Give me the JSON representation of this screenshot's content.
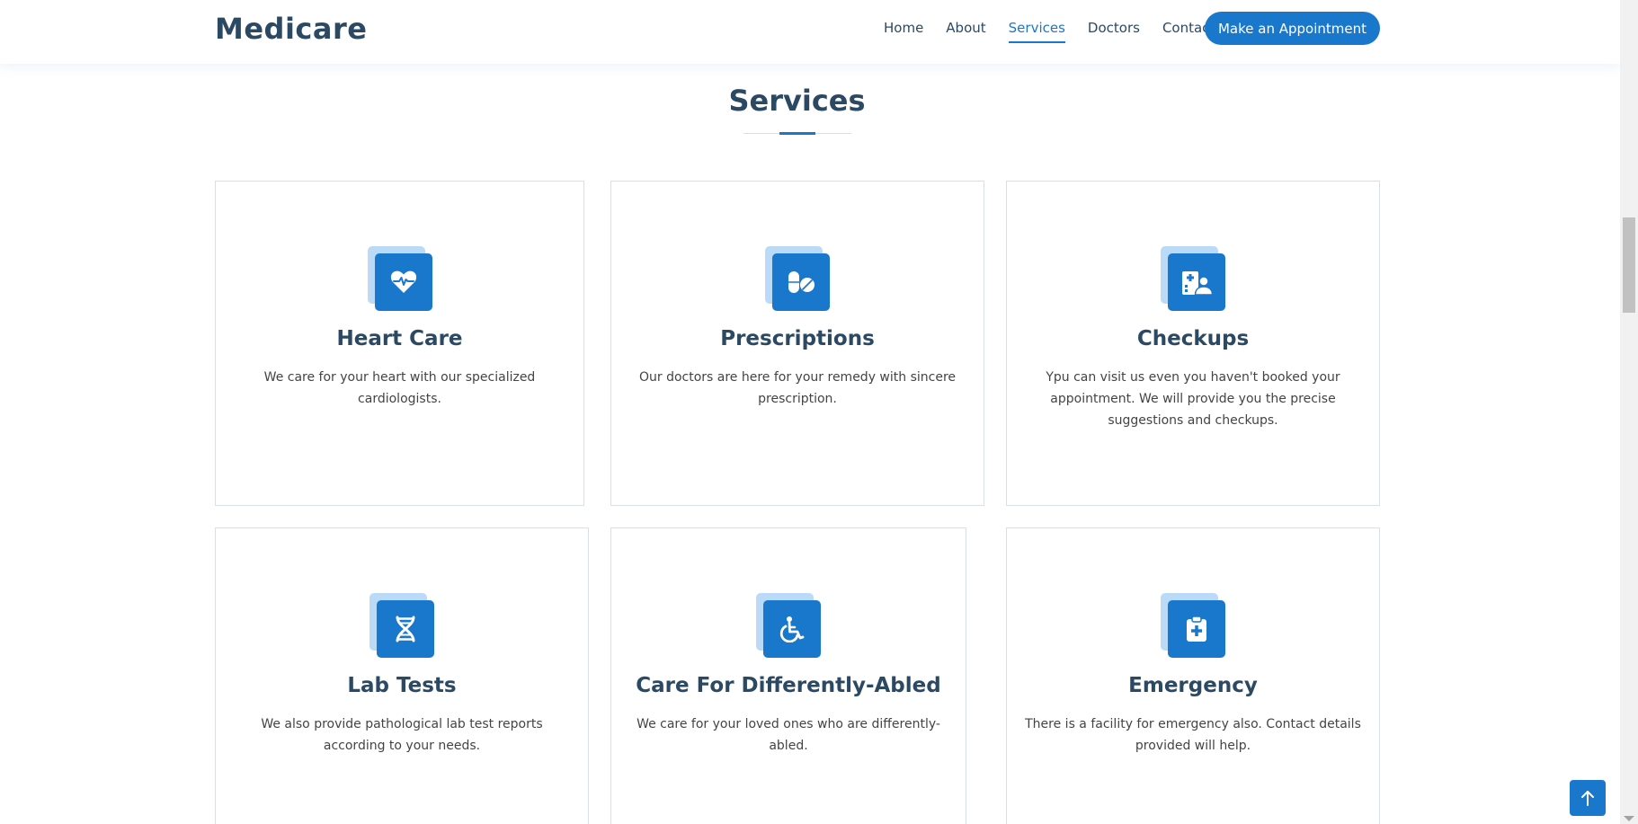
{
  "header": {
    "logo": "Medicare",
    "nav": [
      {
        "label": "Home"
      },
      {
        "label": "About"
      },
      {
        "label": "Services"
      },
      {
        "label": "Doctors"
      },
      {
        "label": "Contact"
      }
    ],
    "active_nav": "Services",
    "cta_label": "Make an Appointment"
  },
  "section": {
    "title": "Services"
  },
  "services": [
    {
      "title": "Heart Care",
      "icon": "heart-pulse-icon",
      "description": "We care for your heart with our specialized cardiologists."
    },
    {
      "title": "Prescriptions",
      "icon": "pills-icon",
      "description": "Our doctors are here for your remedy with sincere prescription."
    },
    {
      "title": "Checkups",
      "icon": "hospital-user-icon",
      "description": "Ypu can visit us even you haven't booked your appointment. We will provide you the precise suggestions and checkups."
    },
    {
      "title": "Lab Tests",
      "icon": "dna-icon",
      "description": "We also provide pathological lab test reports according to your needs."
    },
    {
      "title": "Care For Differently-Abled",
      "icon": "wheelchair-icon",
      "description": "We care for your loved ones who are differently-abled."
    },
    {
      "title": "Emergency",
      "icon": "medical-clipboard-icon",
      "description": "There is a facility for emergency also. Contact details provided will help."
    }
  ],
  "colors": {
    "accent": "#1977cc",
    "accent_light": "#badaf7",
    "heading": "#2c4964",
    "text": "#444444"
  },
  "widgets": {
    "back_to_top_icon": "arrow-up-icon"
  }
}
